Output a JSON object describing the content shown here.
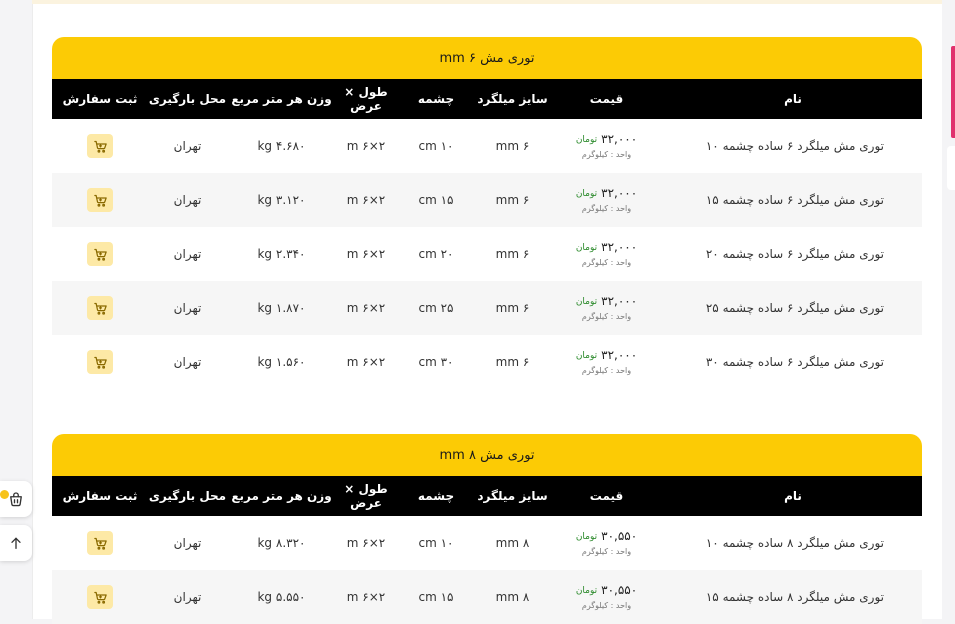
{
  "headers": {
    "name": "نام",
    "price": "قیمت",
    "size": "سایز میلگرد",
    "mesh": "چشمه",
    "dimensions": "طول × عرض",
    "weight": "وزن هر متر مربع",
    "location": "محل بارگیری",
    "order": "ثبت سفارش"
  },
  "tables": [
    {
      "title": "توری مش ۶ mm",
      "rows": [
        {
          "name": "توری مش میلگرد ۶ ساده چشمه ۱۰",
          "price": "۳۲,۰۰۰",
          "currency": "تومان",
          "unit": "واحد : کیلوگرم",
          "size": "۶ mm",
          "mesh": "۱۰ cm",
          "dimensions": "۲×۶ m",
          "weight": "۴.۶۸۰ kg",
          "location": "تهران"
        },
        {
          "name": "توری مش میلگرد ۶ ساده چشمه ۱۵",
          "price": "۳۲,۰۰۰",
          "currency": "تومان",
          "unit": "واحد : کیلوگرم",
          "size": "۶ mm",
          "mesh": "۱۵ cm",
          "dimensions": "۲×۶ m",
          "weight": "۳.۱۲۰ kg",
          "location": "تهران"
        },
        {
          "name": "توری مش میلگرد ۶ ساده چشمه ۲۰",
          "price": "۳۲,۰۰۰",
          "currency": "تومان",
          "unit": "واحد : کیلوگرم",
          "size": "۶ mm",
          "mesh": "۲۰ cm",
          "dimensions": "۲×۶ m",
          "weight": "۲.۳۴۰ kg",
          "location": "تهران"
        },
        {
          "name": "توری مش میلگرد ۶ ساده چشمه ۲۵",
          "price": "۳۲,۰۰۰",
          "currency": "تومان",
          "unit": "واحد : کیلوگرم",
          "size": "۶ mm",
          "mesh": "۲۵ cm",
          "dimensions": "۲×۶ m",
          "weight": "۱.۸۷۰ kg",
          "location": "تهران"
        },
        {
          "name": "توری مش میلگرد ۶ ساده چشمه ۳۰",
          "price": "۳۲,۰۰۰",
          "currency": "تومان",
          "unit": "واحد : کیلوگرم",
          "size": "۶ mm",
          "mesh": "۳۰ cm",
          "dimensions": "۲×۶ m",
          "weight": "۱.۵۶۰ kg",
          "location": "تهران"
        }
      ]
    },
    {
      "title": "توری مش ۸ mm",
      "rows": [
        {
          "name": "توری مش میلگرد ۸ ساده چشمه ۱۰",
          "price": "۳۰,۵۵۰",
          "currency": "تومان",
          "unit": "واحد : کیلوگرم",
          "size": "۸ mm",
          "mesh": "۱۰ cm",
          "dimensions": "۲×۶ m",
          "weight": "۸.۳۲۰ kg",
          "location": "تهران"
        },
        {
          "name": "توری مش میلگرد ۸ ساده چشمه ۱۵",
          "price": "۳۰,۵۵۰",
          "currency": "تومان",
          "unit": "واحد : کیلوگرم",
          "size": "۸ mm",
          "mesh": "۱۵ cm",
          "dimensions": "۲×۶ m",
          "weight": "۵.۵۵۰ kg",
          "location": "تهران"
        }
      ]
    }
  ],
  "icons": {
    "cart": "cart-icon",
    "basket": "basket-icon",
    "scroll_top": "arrow-up-icon"
  },
  "colors": {
    "accent": "#fccb05",
    "header_bg": "#000000",
    "cart_bg": "#fde9a6",
    "currency": "#2b8a2b",
    "side_accent": "#e0316d"
  }
}
